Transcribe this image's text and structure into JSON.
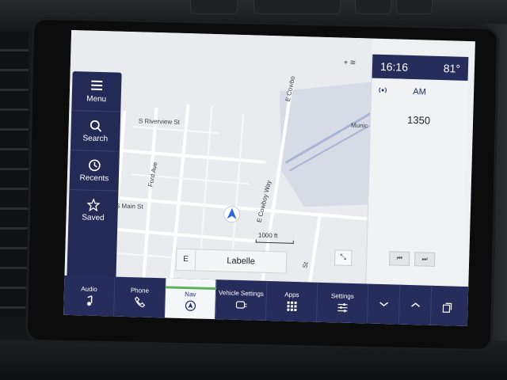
{
  "status": {
    "time": "16:16",
    "temperature": "81°"
  },
  "side_menu": {
    "items": [
      {
        "label": "Menu",
        "icon": "menu-icon"
      },
      {
        "label": "Search",
        "icon": "search-icon"
      },
      {
        "label": "Recents",
        "icon": "history-icon"
      },
      {
        "label": "Saved",
        "icon": "star-icon"
      }
    ]
  },
  "map": {
    "streets": [
      "S Riverview St",
      "Ford Ave",
      "S Main St",
      "E Cowboy Way",
      "E Cowbo",
      "St",
      "Munic"
    ],
    "scale": "1000 ft",
    "road_direction": "E",
    "road_name": "Labelle"
  },
  "radio": {
    "band": "AM",
    "frequency": "1350"
  },
  "bottom_bar": {
    "items": [
      {
        "label": "Audio",
        "icon": "music-note-icon"
      },
      {
        "label": "Phone",
        "icon": "phone-icon"
      },
      {
        "label": "Nav",
        "icon": "navigation-icon"
      },
      {
        "label": "Vehicle Settings",
        "icon": "vehicle-settings-icon"
      },
      {
        "label": "Apps",
        "icon": "apps-grid-icon"
      },
      {
        "label": "Settings",
        "icon": "sliders-icon"
      }
    ]
  },
  "colors": {
    "nav_bar": "#262c5c",
    "accent_green": "#5fb35a",
    "map_bg": "#e9ebee"
  }
}
